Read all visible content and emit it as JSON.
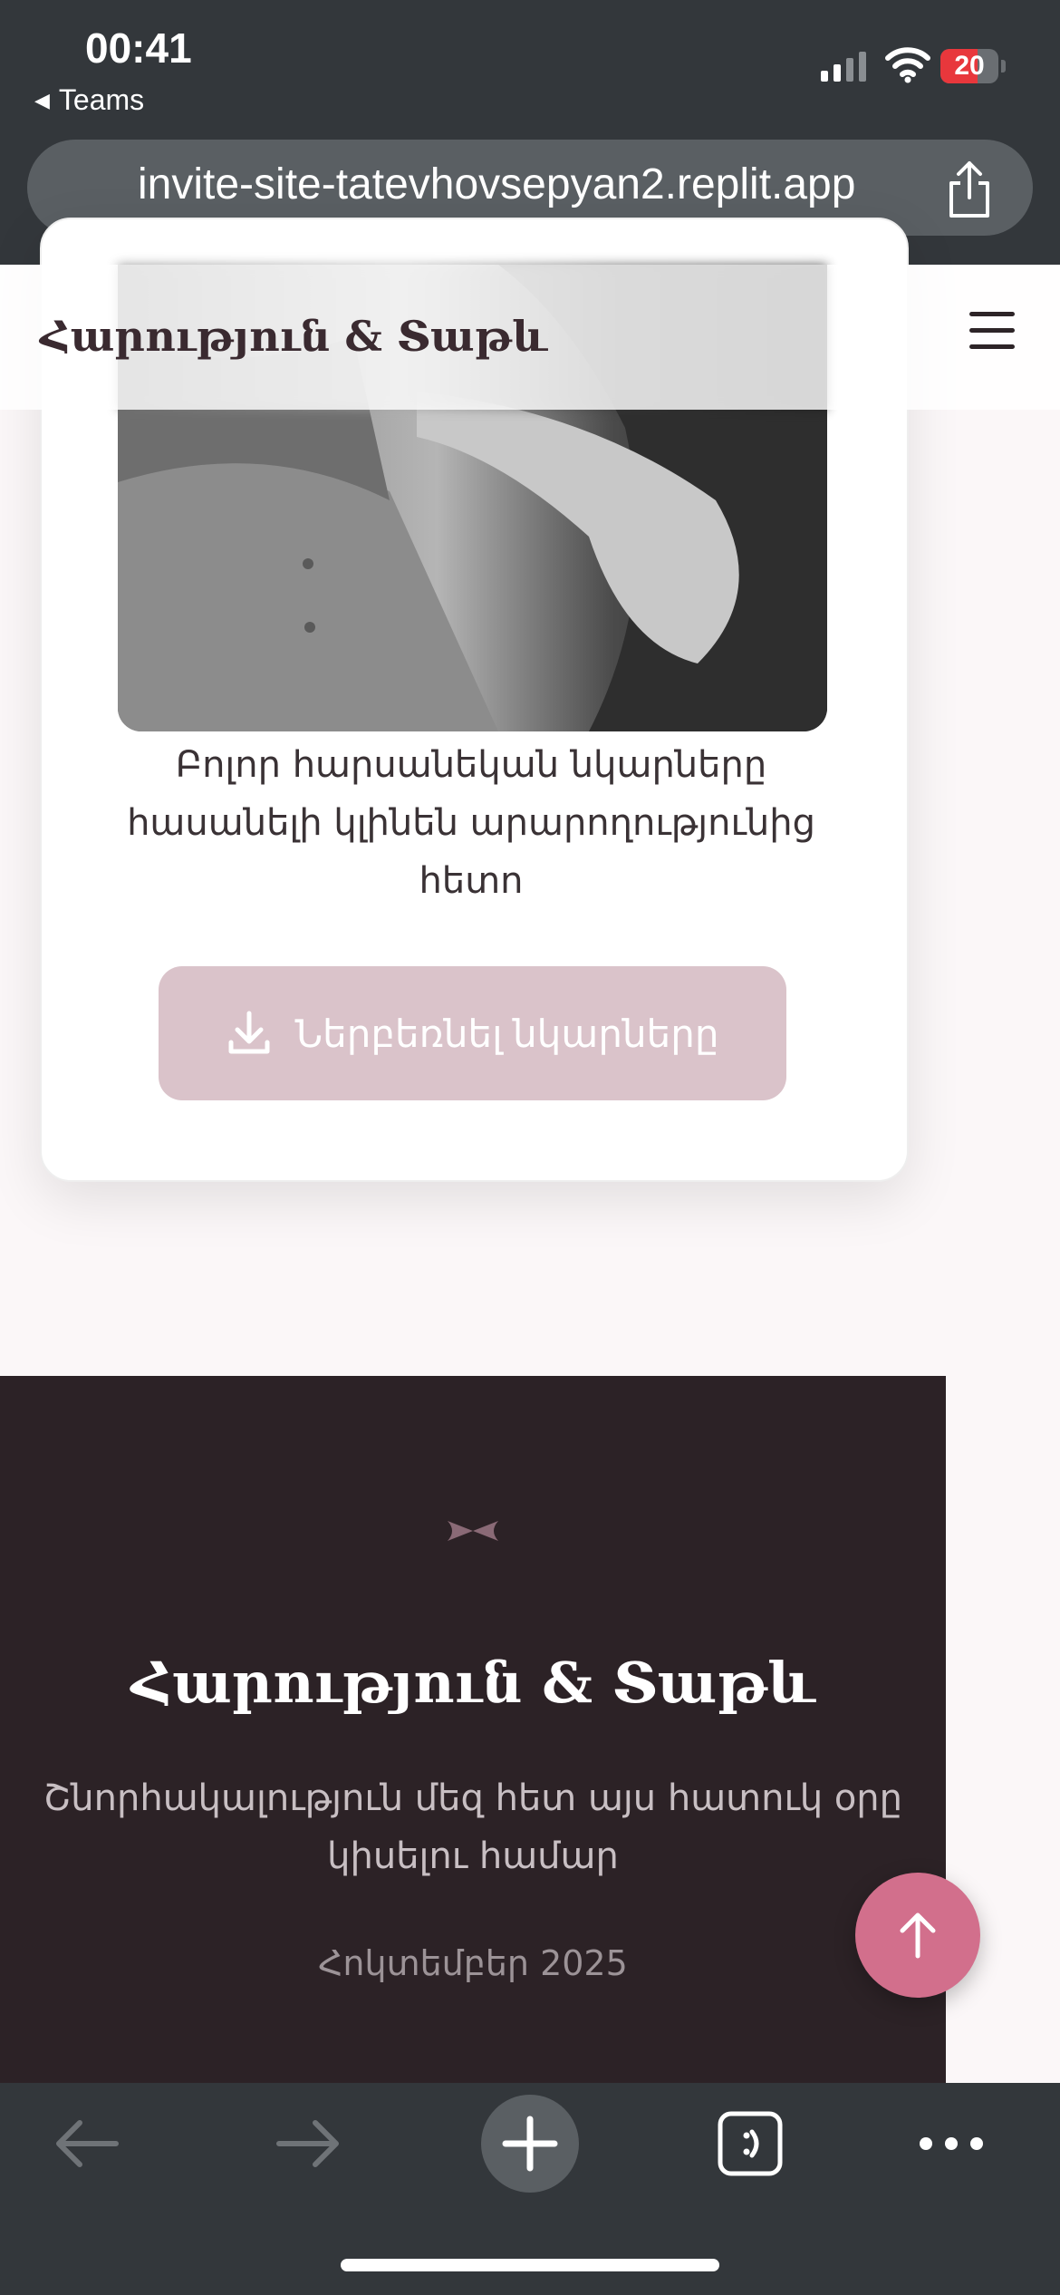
{
  "status_bar": {
    "time": "00:41",
    "back_app": "Teams",
    "battery_level": "20",
    "battery_color": "#e8373c"
  },
  "browser": {
    "url": "invite-site-tatevhovsepyan2.replit.app"
  },
  "site": {
    "logo": "Հարություն & Տաթև",
    "photo_caption": "Բոլոր հարսանեկան նկարները հասանելի կլինեն արարողությունից հետո",
    "download_label": "Ներբեռնել նկարները",
    "footer_title": "Հարություն & Տաթև",
    "footer_subtitle": "Շնորհակալություն մեզ հետ այս հատուկ օրը կիսելու համար",
    "footer_date": "Հոկտեմբեր 2025"
  },
  "colors": {
    "accent": "#d26f8c",
    "button_disabled": "#dac3ca",
    "footer_bg": "#2c2226",
    "chrome_bg": "#33373b"
  },
  "icons": {
    "menu": "hamburger-icon",
    "download": "download-icon",
    "scroll_top": "arrow-up-icon",
    "share": "share-icon",
    "back": "arrow-left-icon",
    "forward": "arrow-right-icon",
    "new_tab": "plus-icon",
    "tabs": "tabs-icon",
    "more": "more-icon"
  }
}
